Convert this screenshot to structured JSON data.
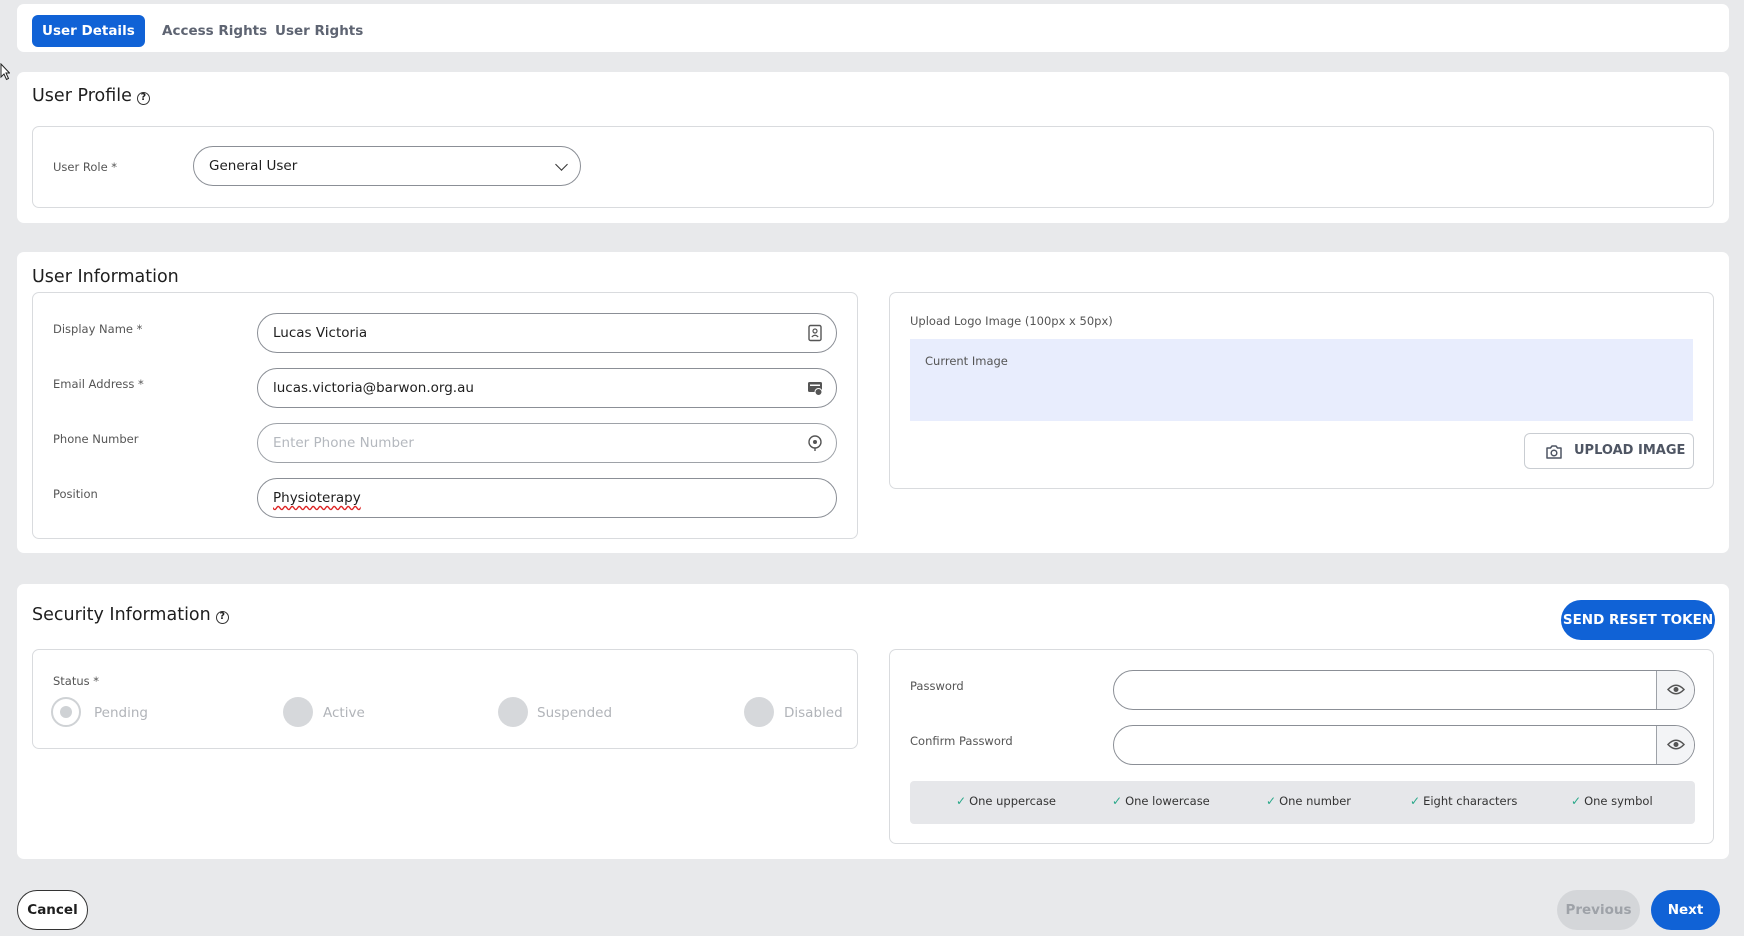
{
  "tabs": [
    {
      "label": "User Details",
      "active": true
    },
    {
      "label": "Access Rights",
      "active": false
    },
    {
      "label": "User Rights",
      "active": false
    }
  ],
  "profile": {
    "title": "User Profile",
    "help_icon": "question-circle-icon",
    "role_label": "User Role *",
    "role_value": "General User"
  },
  "user_info": {
    "title": "User Information",
    "display_name_label": "Display Name *",
    "display_name_value": "Lucas Victoria",
    "email_label": "Email Address *",
    "email_value": "lucas.victoria@barwon.org.au",
    "phone_label": "Phone Number",
    "phone_placeholder": "Enter Phone Number",
    "position_label": "Position",
    "position_value": "Physioterapy",
    "upload_label": "Upload Logo Image (100px x 50px)",
    "current_image_label": "Current Image",
    "upload_button": "UPLOAD IMAGE"
  },
  "security": {
    "title": "Security Information",
    "send_reset_button": "SEND RESET TOKEN",
    "status_label": "Status *",
    "status_options": [
      "Pending",
      "Active",
      "Suspended",
      "Disabled"
    ],
    "password_label": "Password",
    "confirm_password_label": "Confirm Password",
    "rules": [
      "One uppercase",
      "One lowercase",
      "One number",
      "Eight characters",
      "One symbol"
    ]
  },
  "footer": {
    "cancel": "Cancel",
    "previous": "Previous",
    "next": "Next"
  },
  "colors": {
    "primary": "#1062d6",
    "background": "#e8e9eb",
    "check": "#2aa88a",
    "disabled_button": "#d4d6d9"
  }
}
